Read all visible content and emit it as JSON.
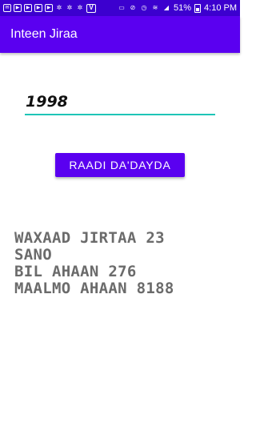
{
  "status_bar": {
    "left_icons": [
      "mail-icon",
      "youtube-icon",
      "youtube-icon",
      "youtube-icon",
      "youtube-icon",
      "gear-icon",
      "gear-icon",
      "gear-icon",
      "vpn-icon"
    ],
    "battery": "51%",
    "time": "4:10 PM"
  },
  "app_bar": {
    "title": "Inteen Jiraa"
  },
  "form": {
    "year_value": "1998",
    "button_label": "RAADI DA'DAYDA"
  },
  "result": {
    "lines": [
      "WAXAAD JIRTAA 23",
      "SANO",
      "BIL AHAAN 276",
      "MAALMO AHAAN 8188"
    ]
  },
  "colors": {
    "status_bar": "#3c00cf",
    "primary": "#5a00f0",
    "accent_underline": "#1ec5b7",
    "result_text": "#6b6b6b"
  }
}
